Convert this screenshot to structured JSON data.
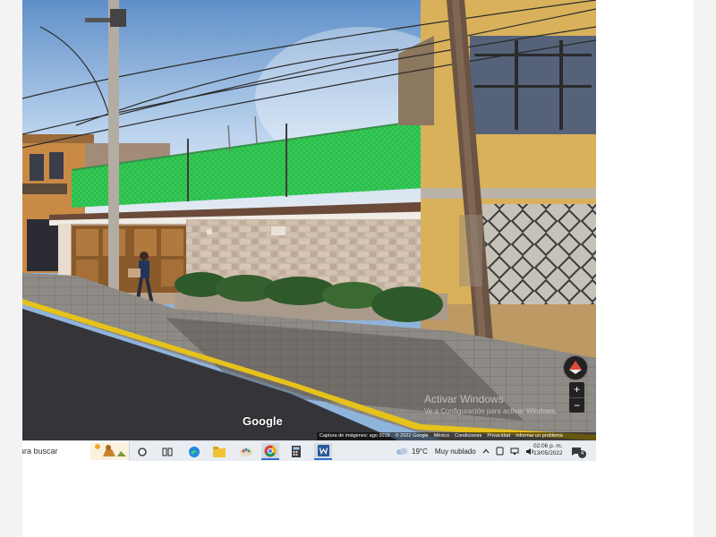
{
  "streetview": {
    "logo": "Google",
    "watermark": {
      "title": "Activar Windows",
      "subtitle": "Ve a Configuración para activar Windows."
    },
    "zoom_in_label": "+",
    "zoom_out_label": "−",
    "attribution": {
      "capture": "Captura de imágenes: ago 2019",
      "copyright": "© 2022 Google",
      "country": "México",
      "terms": "Condiciones",
      "privacy": "Privacidad",
      "report": "Informar un problema"
    }
  },
  "taskbar": {
    "search_placeholder": "ara buscar",
    "icons": [
      "cortana-icon",
      "task-view-icon",
      "edge-icon",
      "file-explorer-icon",
      "paint-icon",
      "chrome-icon",
      "calculator-icon",
      "word-icon"
    ],
    "weather": {
      "temp": "19°C",
      "condition": "Muy nublado"
    },
    "clock": {
      "time": "02:06 p. m.",
      "date": "13/05/2022"
    },
    "notification_count": "4"
  },
  "colors": {
    "taskbar_bg": "#e9edf2",
    "active_indicator": "#2f6ecf",
    "mesh_green": "#2fcf55",
    "curb_yellow": "#e6c21b"
  }
}
